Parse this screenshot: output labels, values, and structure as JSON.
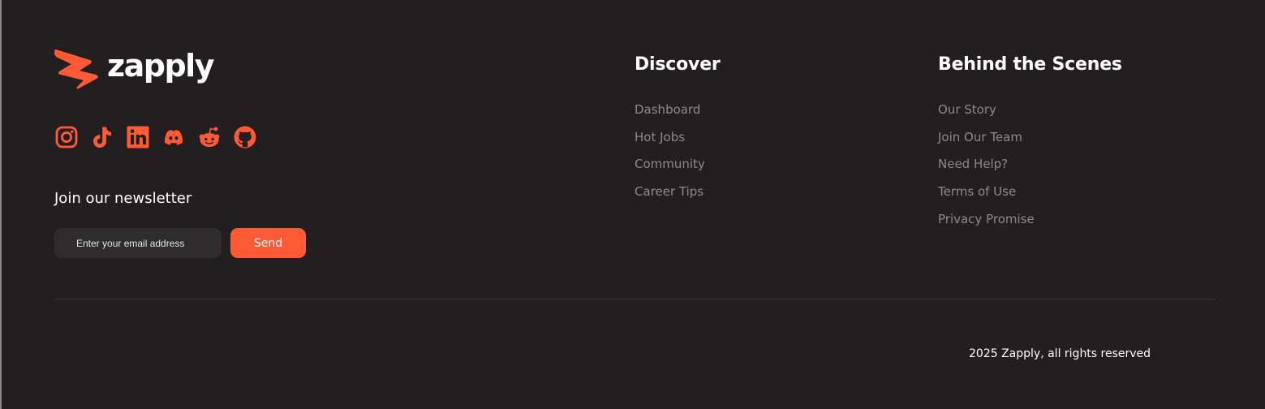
{
  "brand": {
    "name": "zapply",
    "logo_icon": "zapply-logo-mark-icon"
  },
  "colors": {
    "background": "#231f21",
    "accent": "#ff5a36",
    "heading": "#ffffff",
    "link": "#8c8a8b",
    "input_bg": "#2f2c2e",
    "divider": "#3a3638"
  },
  "social": [
    {
      "name": "Instagram",
      "icon": "instagram-icon"
    },
    {
      "name": "TikTok",
      "icon": "tiktok-icon"
    },
    {
      "name": "LinkedIn",
      "icon": "linkedin-icon"
    },
    {
      "name": "Discord",
      "icon": "discord-icon"
    },
    {
      "name": "Reddit",
      "icon": "reddit-icon"
    },
    {
      "name": "GitHub",
      "icon": "github-icon"
    }
  ],
  "newsletter": {
    "title": "Join our newsletter",
    "placeholder": "Enter your email address",
    "value": "",
    "button": "Send"
  },
  "discover": {
    "title": "Discover",
    "links": [
      "Dashboard",
      "Hot Jobs",
      "Community",
      "Career Tips"
    ]
  },
  "behind": {
    "title": "Behind the Scenes",
    "links": [
      "Our Story",
      "Join Our Team",
      "Need Help?",
      "Terms of Use",
      "Privacy Promise"
    ]
  },
  "copyright": "2025 Zapply, all rights reserved"
}
